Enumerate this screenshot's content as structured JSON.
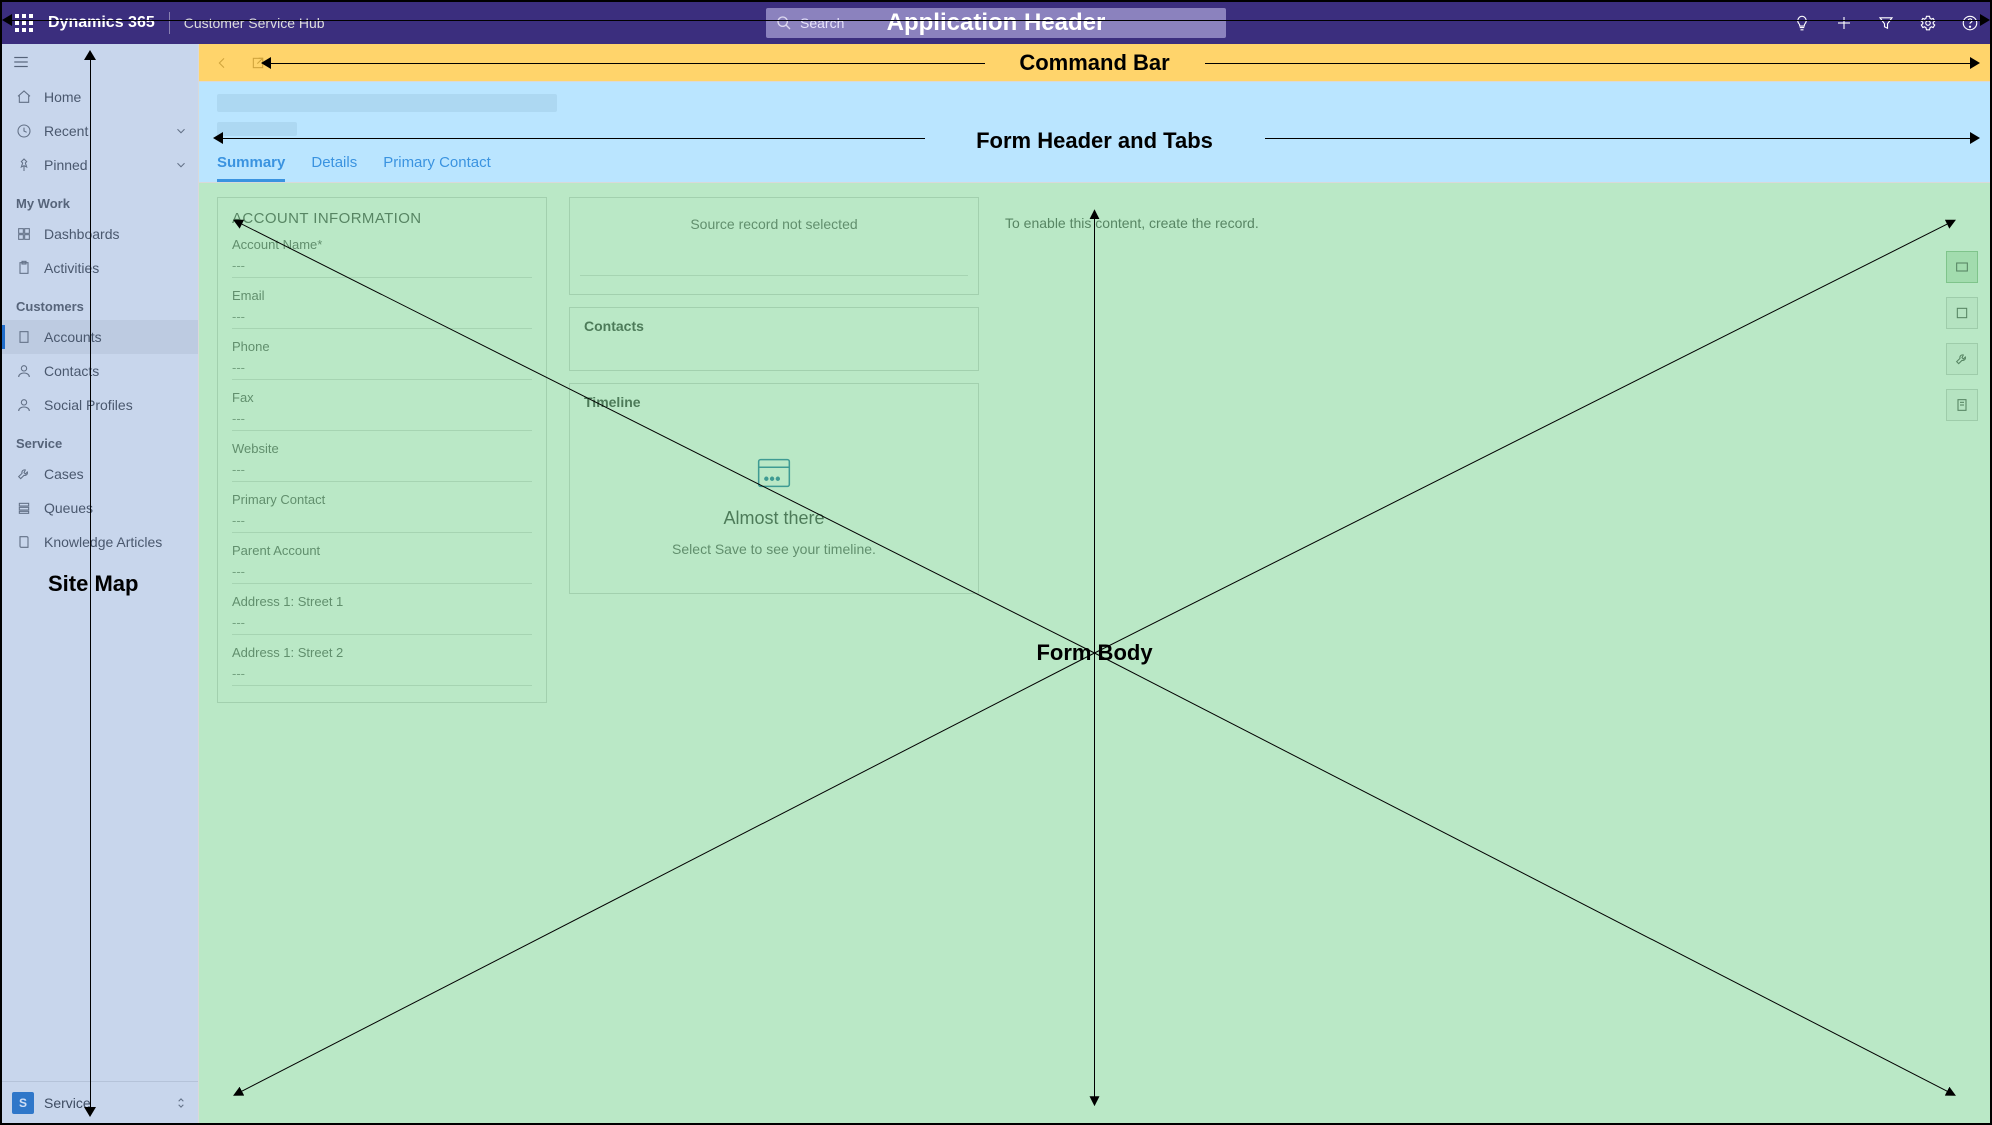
{
  "header": {
    "product": "Dynamics 365",
    "app": "Customer Service Hub",
    "search_placeholder": "Search",
    "icons": [
      "lightbulb",
      "plus",
      "filter",
      "settings",
      "help"
    ]
  },
  "annotations": {
    "app_header": "Application Header",
    "command_bar": "Command Bar",
    "form_header": "Form Header and Tabs",
    "site_map": "Site Map",
    "form_body": "Form Body"
  },
  "sidebar": {
    "top": [
      {
        "id": "home",
        "label": "Home",
        "icon": "home"
      },
      {
        "id": "recent",
        "label": "Recent",
        "icon": "clock",
        "expand": true
      },
      {
        "id": "pinned",
        "label": "Pinned",
        "icon": "pin",
        "expand": true
      }
    ],
    "groups": [
      {
        "title": "My Work",
        "items": [
          {
            "id": "dashboards",
            "label": "Dashboards",
            "icon": "grid"
          },
          {
            "id": "activities",
            "label": "Activities",
            "icon": "clipboard"
          }
        ]
      },
      {
        "title": "Customers",
        "items": [
          {
            "id": "accounts",
            "label": "Accounts",
            "icon": "building",
            "active": true
          },
          {
            "id": "contacts",
            "label": "Contacts",
            "icon": "person"
          },
          {
            "id": "social",
            "label": "Social Profiles",
            "icon": "person"
          }
        ]
      },
      {
        "title": "Service",
        "items": [
          {
            "id": "cases",
            "label": "Cases",
            "icon": "wrench"
          },
          {
            "id": "queues",
            "label": "Queues",
            "icon": "stack"
          },
          {
            "id": "kb",
            "label": "Knowledge Articles",
            "icon": "book"
          }
        ]
      }
    ],
    "area": {
      "initial": "S",
      "label": "Service"
    }
  },
  "tabs": [
    {
      "id": "summary",
      "label": "Summary",
      "active": true
    },
    {
      "id": "details",
      "label": "Details"
    },
    {
      "id": "primary",
      "label": "Primary Contact"
    }
  ],
  "form": {
    "section_title": "ACCOUNT INFORMATION",
    "empty": "---",
    "fields": [
      {
        "label": "Account Name*"
      },
      {
        "label": "Email"
      },
      {
        "label": "Phone"
      },
      {
        "label": "Fax"
      },
      {
        "label": "Website"
      },
      {
        "label": "Primary Contact"
      },
      {
        "label": "Parent Account"
      },
      {
        "label": "Address 1: Street 1"
      },
      {
        "label": "Address 1: Street 2"
      }
    ],
    "source_msg": "Source record not selected",
    "contacts_title": "Contacts",
    "timeline_title": "Timeline",
    "timeline_heading": "Almost there",
    "timeline_sub": "Select Save to see your timeline.",
    "right_msg": "To enable this content, create the record."
  }
}
